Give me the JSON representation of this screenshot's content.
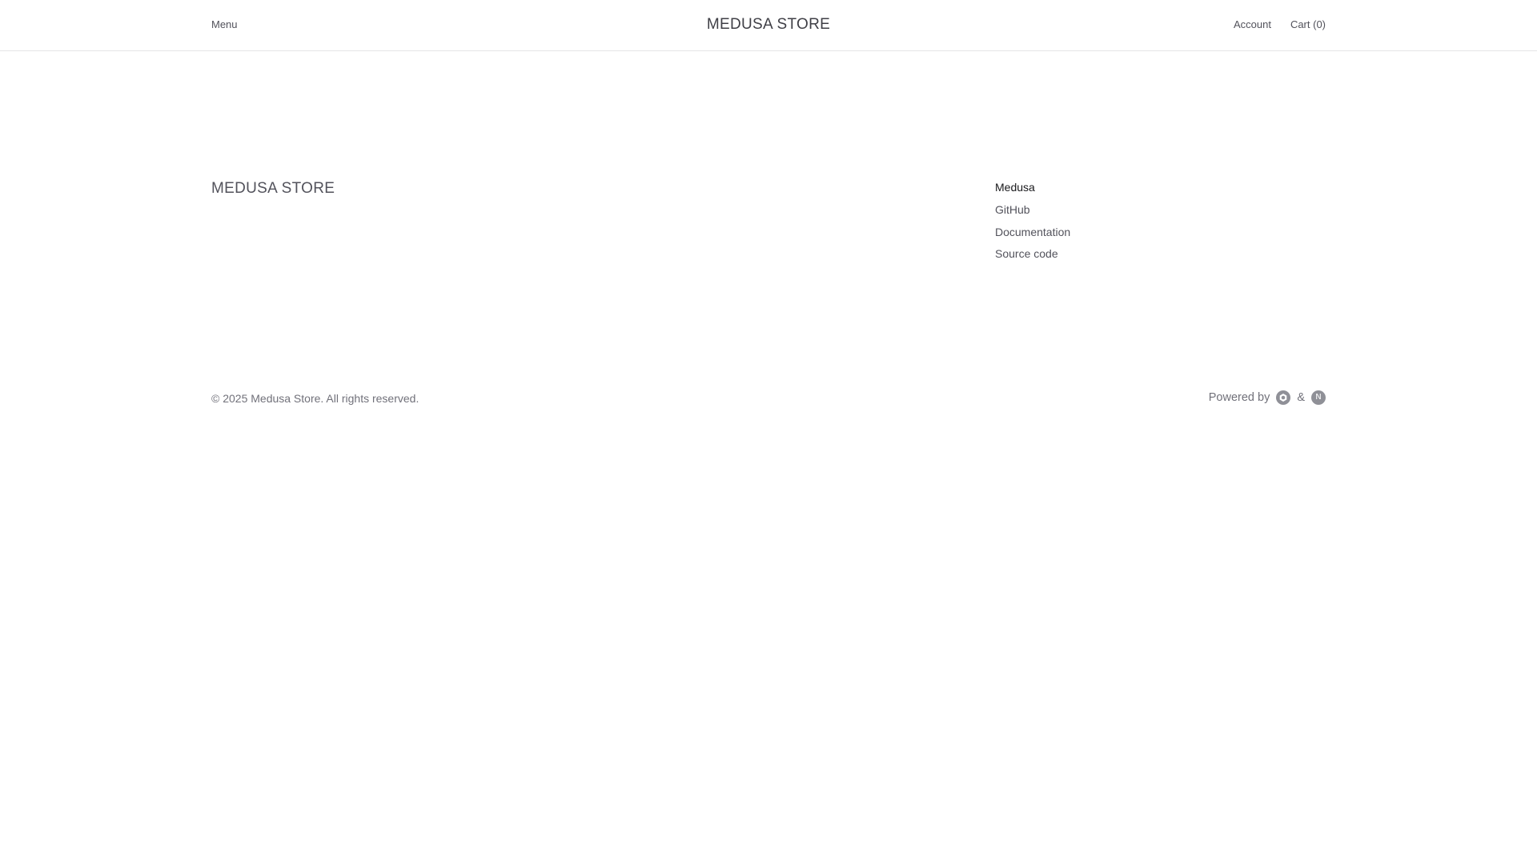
{
  "header": {
    "menu_label": "Menu",
    "store_title": "MEDUSA STORE",
    "account_label": "Account",
    "cart_label": "Cart (0)"
  },
  "footer": {
    "brand": "MEDUSA STORE",
    "links_section": {
      "heading": "Medusa",
      "items": [
        {
          "label": "GitHub"
        },
        {
          "label": "Documentation"
        },
        {
          "label": "Source code"
        }
      ]
    },
    "copyright": "© 2025 Medusa Store. All rights reserved.",
    "powered_by": {
      "prefix": "Powered by",
      "separator": "&",
      "logos": [
        {
          "icon": "medusa-logo-icon"
        },
        {
          "icon": "nextjs-logo-icon",
          "letter": "N"
        }
      ]
    }
  },
  "colors": {
    "background": "#ffffff",
    "text": "#52525b",
    "heading": "#18181b",
    "muted": "#71717a",
    "border": "#e4e4e7",
    "logo_fill": "#8f9097"
  }
}
